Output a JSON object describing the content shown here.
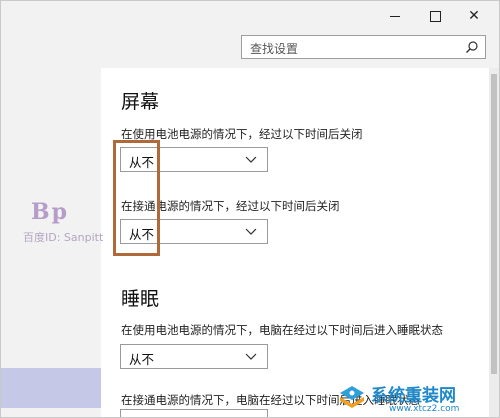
{
  "window": {
    "minimize_icon": "minimize-icon",
    "maximize_icon": "maximize-icon",
    "close_glyph": "✕"
  },
  "search": {
    "placeholder": "查找设置",
    "icon": "search-icon"
  },
  "screen": {
    "title": "屏幕",
    "battery_label": "在使用电池电源的情况下，经过以下时间后关闭",
    "battery_value": "从不",
    "plugged_label": "在接通电源的情况下，经过以下时间后关闭",
    "plugged_value": "从不"
  },
  "sleep": {
    "title": "睡眠",
    "battery_label": "在使用电池电源的情况下，电脑在经过以下时间后进入睡眠状态",
    "battery_value": "从不",
    "plugged_label": "在接通电源的情况下，电脑在经过以下时间后进入睡眠状态"
  },
  "watermark": {
    "logo_text": "Bp",
    "text": "百度ID: Sanpitt"
  },
  "brand": {
    "name": "系统重装网",
    "url": "www.xtcz2.com"
  },
  "colors": {
    "highlight": "#b06a3a",
    "sidebar_selected": "#c5c9e7",
    "brand": "#1e88c8"
  }
}
